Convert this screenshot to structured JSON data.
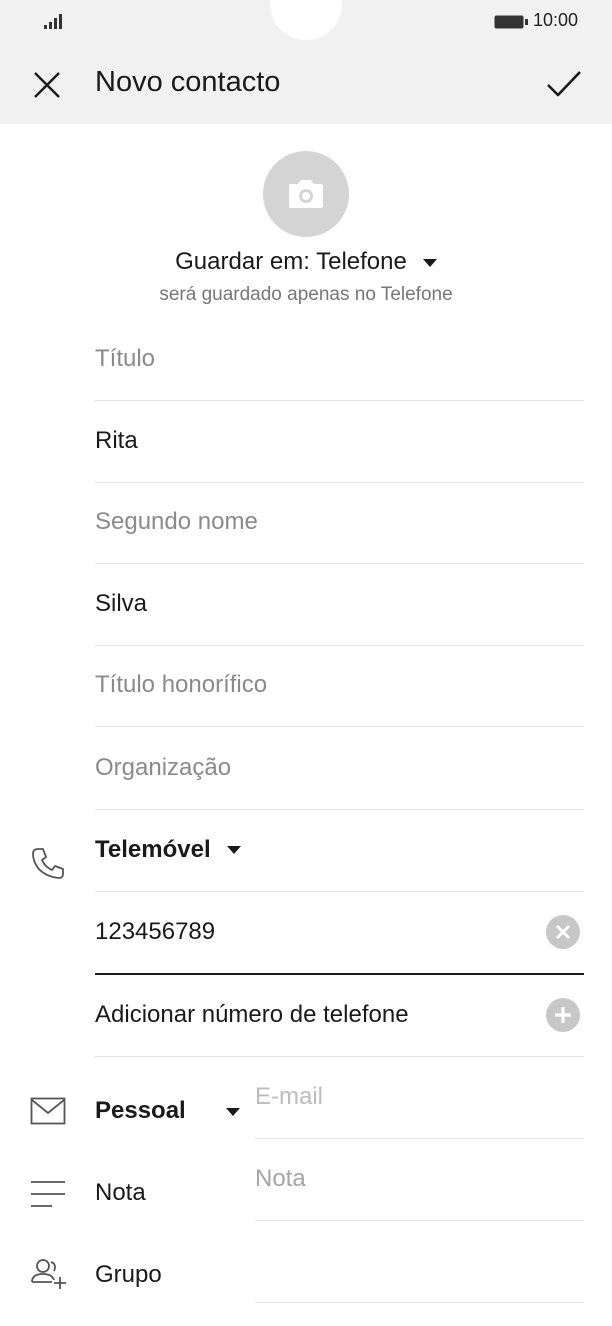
{
  "status": {
    "time": "10:00"
  },
  "header": {
    "title": "Novo contacto"
  },
  "save": {
    "label": "Guardar em: Telefone",
    "sub": "será guardado apenas no Telefone"
  },
  "fields": {
    "title_ph": "Título",
    "first_name": "Rita",
    "middle_ph": "Segundo nome",
    "last_name": "Silva",
    "suffix_ph": "Título honorífico",
    "org_ph": "Organização"
  },
  "phone": {
    "type": "Telemóvel",
    "number": "123456789",
    "add": "Adicionar número de telefone"
  },
  "email": {
    "type": "Pessoal",
    "placeholder": "E-mail"
  },
  "note": {
    "label": "Nota",
    "placeholder": "Nota"
  },
  "group": {
    "label": "Grupo"
  },
  "colors": {
    "header_bg": "#f1f1f1",
    "accent_gray": "#c7c7c7"
  }
}
